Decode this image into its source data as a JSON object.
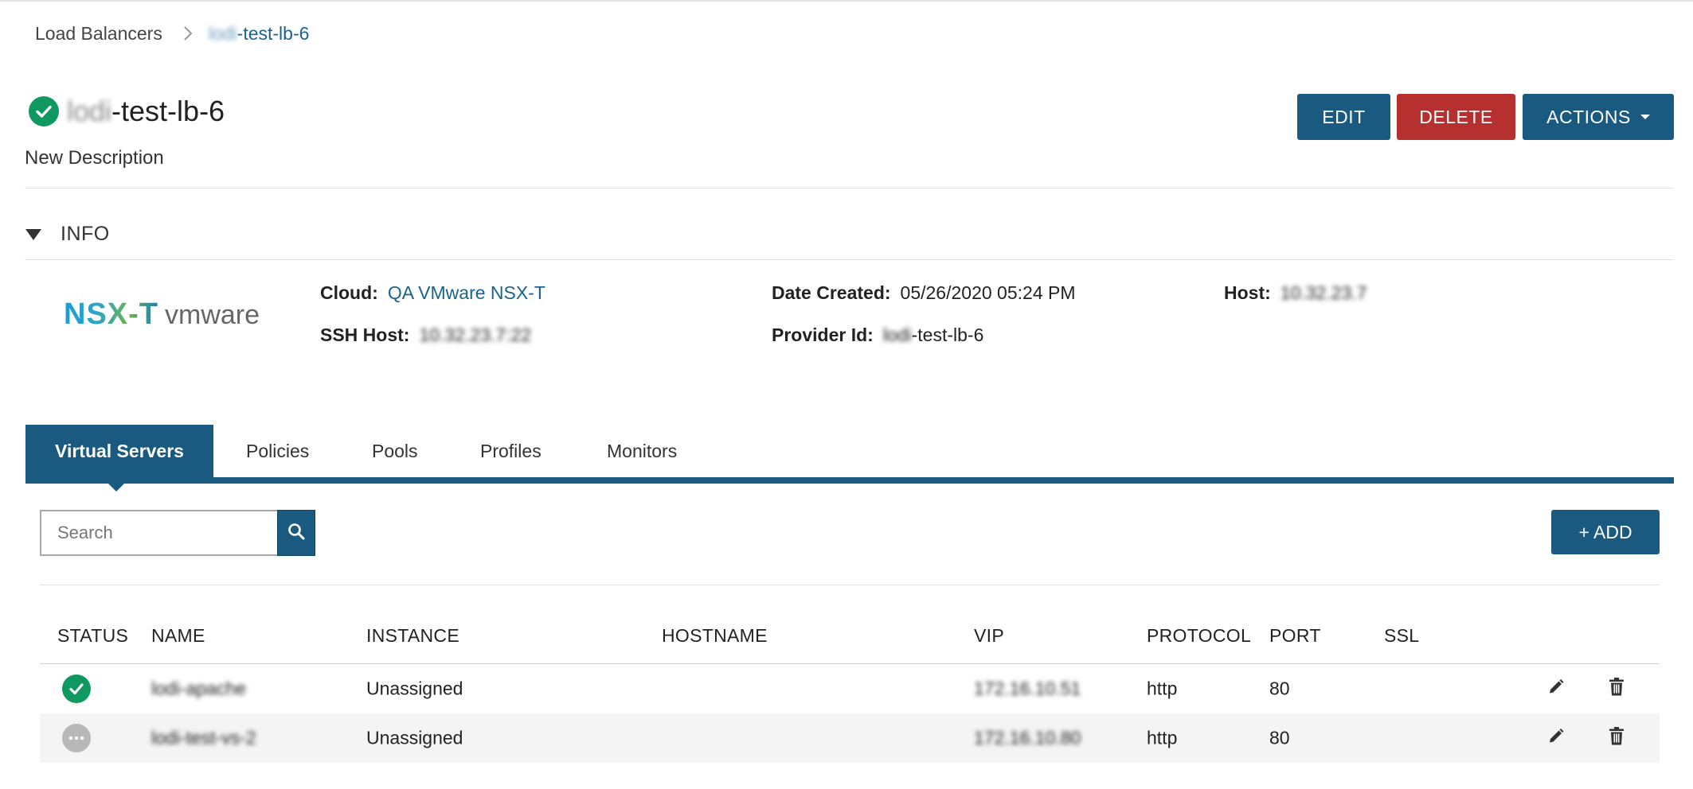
{
  "breadcrumb": {
    "root": "Load Balancers",
    "current_blurred": "lodi",
    "current_suffix": "-test-lb-6"
  },
  "header": {
    "title_blurred": "lodi",
    "title_suffix": "-test-lb-6",
    "description": "New Description",
    "buttons": {
      "edit": "EDIT",
      "delete": "DELETE",
      "actions": "ACTIONS"
    }
  },
  "info": {
    "section_label": "INFO",
    "logo": {
      "primary": "NSX-T",
      "secondary": "vmware"
    },
    "cloud": {
      "label": "Cloud:",
      "value": "QA VMware NSX-T"
    },
    "ssh_host": {
      "label": "SSH Host:",
      "value_blurred": "10.32.23.7:22"
    },
    "date_created": {
      "label": "Date Created:",
      "value": "05/26/2020 05:24 PM"
    },
    "provider_id": {
      "label": "Provider Id:",
      "value_blurred": "lodi",
      "value_suffix": "-test-lb-6"
    },
    "host": {
      "label": "Host:",
      "value_blurred": "10.32.23.7"
    }
  },
  "tabs": [
    {
      "label": "Virtual Servers",
      "active": true
    },
    {
      "label": "Policies",
      "active": false
    },
    {
      "label": "Pools",
      "active": false
    },
    {
      "label": "Profiles",
      "active": false
    },
    {
      "label": "Monitors",
      "active": false
    }
  ],
  "toolbar": {
    "search_placeholder": "Search",
    "add_label": "+ ADD"
  },
  "table": {
    "columns": [
      "STATUS",
      "NAME",
      "INSTANCE",
      "HOSTNAME",
      "VIP",
      "PROTOCOL",
      "PORT",
      "SSL"
    ],
    "rows": [
      {
        "status": "ok",
        "name_blurred": "lodi-apache",
        "instance": "Unassigned",
        "hostname": "",
        "vip_blurred": "172.16.10.51",
        "protocol": "http",
        "port": "80",
        "ssl": ""
      },
      {
        "status": "unknown",
        "name_blurred": "lodi-test-vs-2",
        "instance": "Unassigned",
        "hostname": "",
        "vip_blurred": "172.16.10.80",
        "protocol": "http",
        "port": "80",
        "ssl": ""
      }
    ]
  },
  "colors": {
    "primary": "#1a5a80",
    "danger": "#b5302e",
    "success": "#0f9960",
    "link": "#1a6390"
  }
}
